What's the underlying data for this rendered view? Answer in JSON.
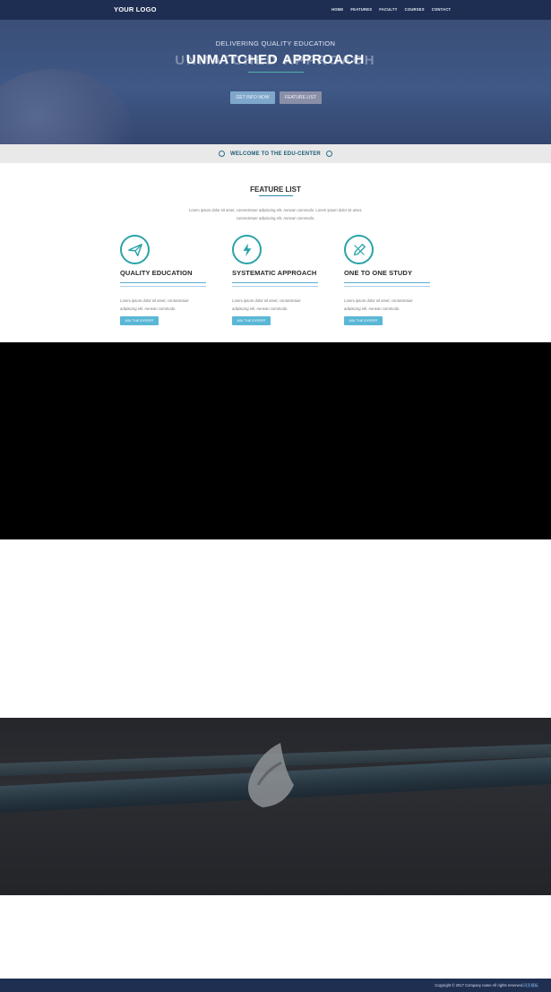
{
  "nav": {
    "logo": "YOUR LOGO",
    "items": [
      {
        "label": "HOME"
      },
      {
        "label": "FEATURES"
      },
      {
        "label": "FACULTY"
      },
      {
        "label": "COURSES"
      },
      {
        "label": "CONTACT"
      }
    ]
  },
  "hero": {
    "kicker": "DELIVERING QUALITY EDUCATION",
    "title": "UNMATCHED APPROACH",
    "buttons": [
      {
        "label": "GET INFO NOW"
      },
      {
        "label": "FEATURE LIST"
      }
    ]
  },
  "welcome": {
    "text": "WELCOME TO THE EDU-CENTER"
  },
  "features": {
    "title": "FEATURE LIST",
    "description_line1": "Lorem ipsum dolor sit amet, consectetuer adipiscing elit. Aenean commodo. Lorem ipsum dolor sit amet,",
    "description_line2": "consectetuer adipiscing elit. Aenean commodo.",
    "columns": [
      {
        "icon": "paper-plane-icon",
        "title": "QUALITY EDUCATION",
        "text": "Lorem ipsum dolor sit amet, consectetuer adipiscing elit. Aenean commodo.",
        "button": "ASK THE EXPERT"
      },
      {
        "icon": "lightning-bolt-icon",
        "title": "SYSTEMATIC APPROACH",
        "text": "Lorem ipsum dolor sit amet, consectetuer adipiscing elit. Aenean commodo.",
        "button": "ASK THE EXPERT"
      },
      {
        "icon": "pencil-ruler-icon",
        "title": "ONE TO ONE STUDY",
        "text": "Lorem ipsum dolor sit amet, consectetuer adipiscing elit. Aenean commodo.",
        "button": "ASK THE EXPERT"
      }
    ]
  },
  "footer": {
    "text": "Copyright © 2017 Company name All rights reserved.",
    "link": "网页模板"
  },
  "colors": {
    "nav_bg": "#1e2e52",
    "accent_teal": "#2aa3a8",
    "button_blue": "#5ab7d6"
  }
}
